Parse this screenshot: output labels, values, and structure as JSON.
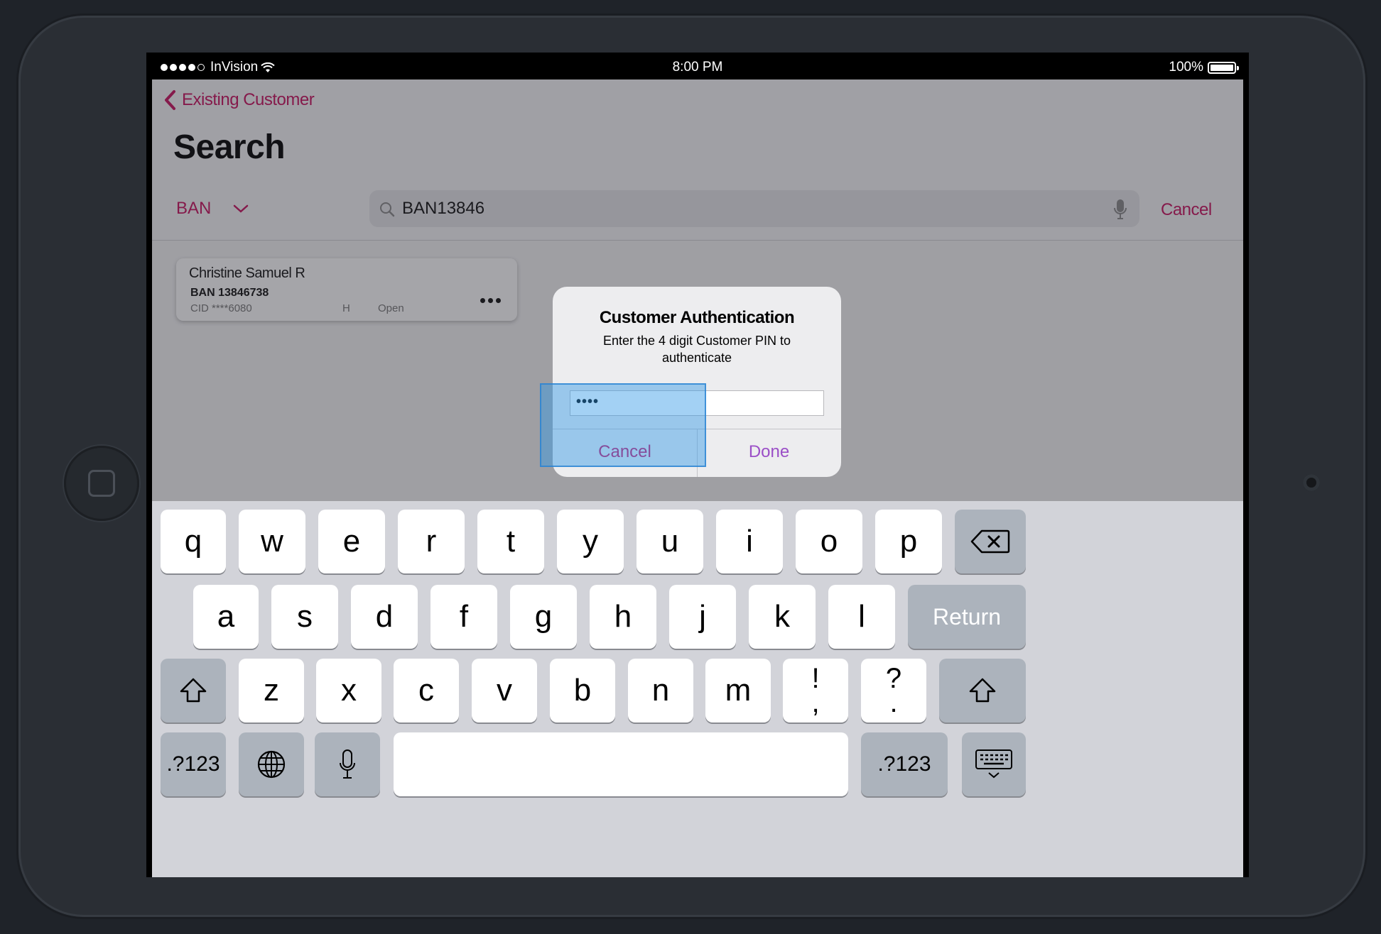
{
  "status_bar": {
    "carrier": "InVision",
    "time": "8:00 PM",
    "battery": "100%",
    "signal_bars": 4
  },
  "nav": {
    "back_label": "Existing Customer",
    "title": "Search",
    "filter_label": "BAN",
    "search_value": "BAN13846",
    "cancel_label": "Cancel"
  },
  "result_card": {
    "name": "Christine Samuel R",
    "ban": "BAN 13846738",
    "cid": "CID ****6080",
    "type": "H",
    "status": "Open"
  },
  "dialog": {
    "title": "Customer Authentication",
    "message": "Enter the 4 digit Customer PIN to authenticate",
    "pin_value": "••••",
    "cancel_label": "Cancel",
    "done_label": "Done"
  },
  "keyboard": {
    "row1": [
      "q",
      "w",
      "e",
      "r",
      "t",
      "y",
      "u",
      "i",
      "o",
      "p"
    ],
    "row2": [
      "a",
      "s",
      "d",
      "f",
      "g",
      "h",
      "j",
      "k",
      "l"
    ],
    "row3": [
      "z",
      "x",
      "c",
      "v",
      "b",
      "n",
      "m"
    ],
    "punct1": [
      "!",
      ","
    ],
    "punct2": [
      "?",
      "."
    ],
    "return_label": "Return",
    "numbers_label": ".?123"
  },
  "colors": {
    "accent": "#c8105e",
    "done": "#9b4fc7",
    "hotspot": "#3498e6"
  }
}
